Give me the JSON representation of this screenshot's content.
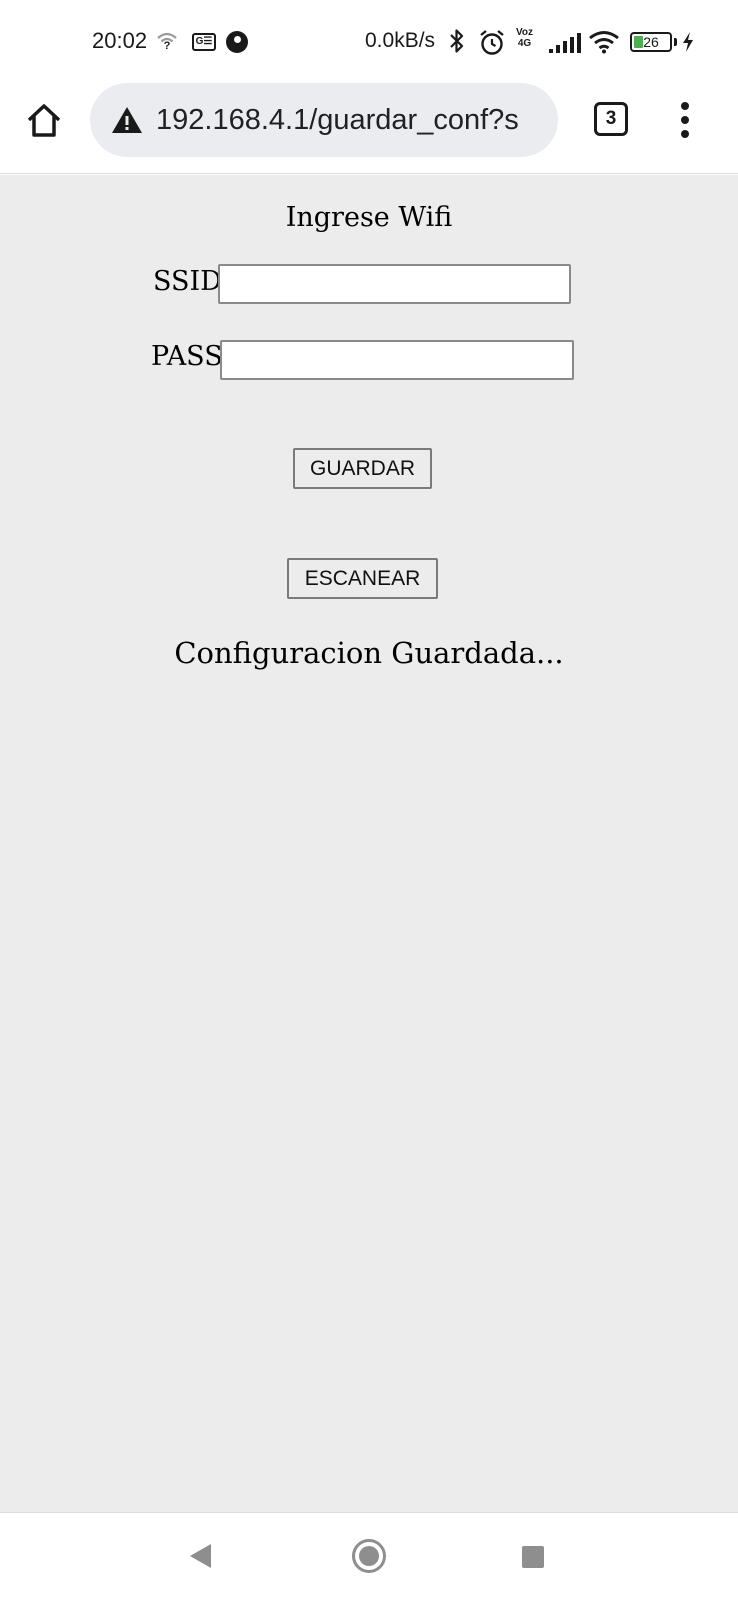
{
  "status_bar": {
    "time": "20:02",
    "ge_badge": "G☰",
    "network_speed": "0.0kB/s",
    "voz_label": "Voz",
    "network_type": "4G",
    "battery_percent": "26",
    "battery_level": 0.26,
    "battery_color": "#4caf50"
  },
  "browser": {
    "url": "192.168.4.1/guardar_conf?s",
    "tab_count": "3"
  },
  "page": {
    "title": "Ingrese Wifi",
    "ssid_label": "SSID",
    "ssid_value": "",
    "pass_label": "PASS",
    "pass_value": "",
    "save_button": "GUARDAR",
    "scan_button": "ESCANEAR",
    "status_message": "Configuracion Guardada..."
  }
}
